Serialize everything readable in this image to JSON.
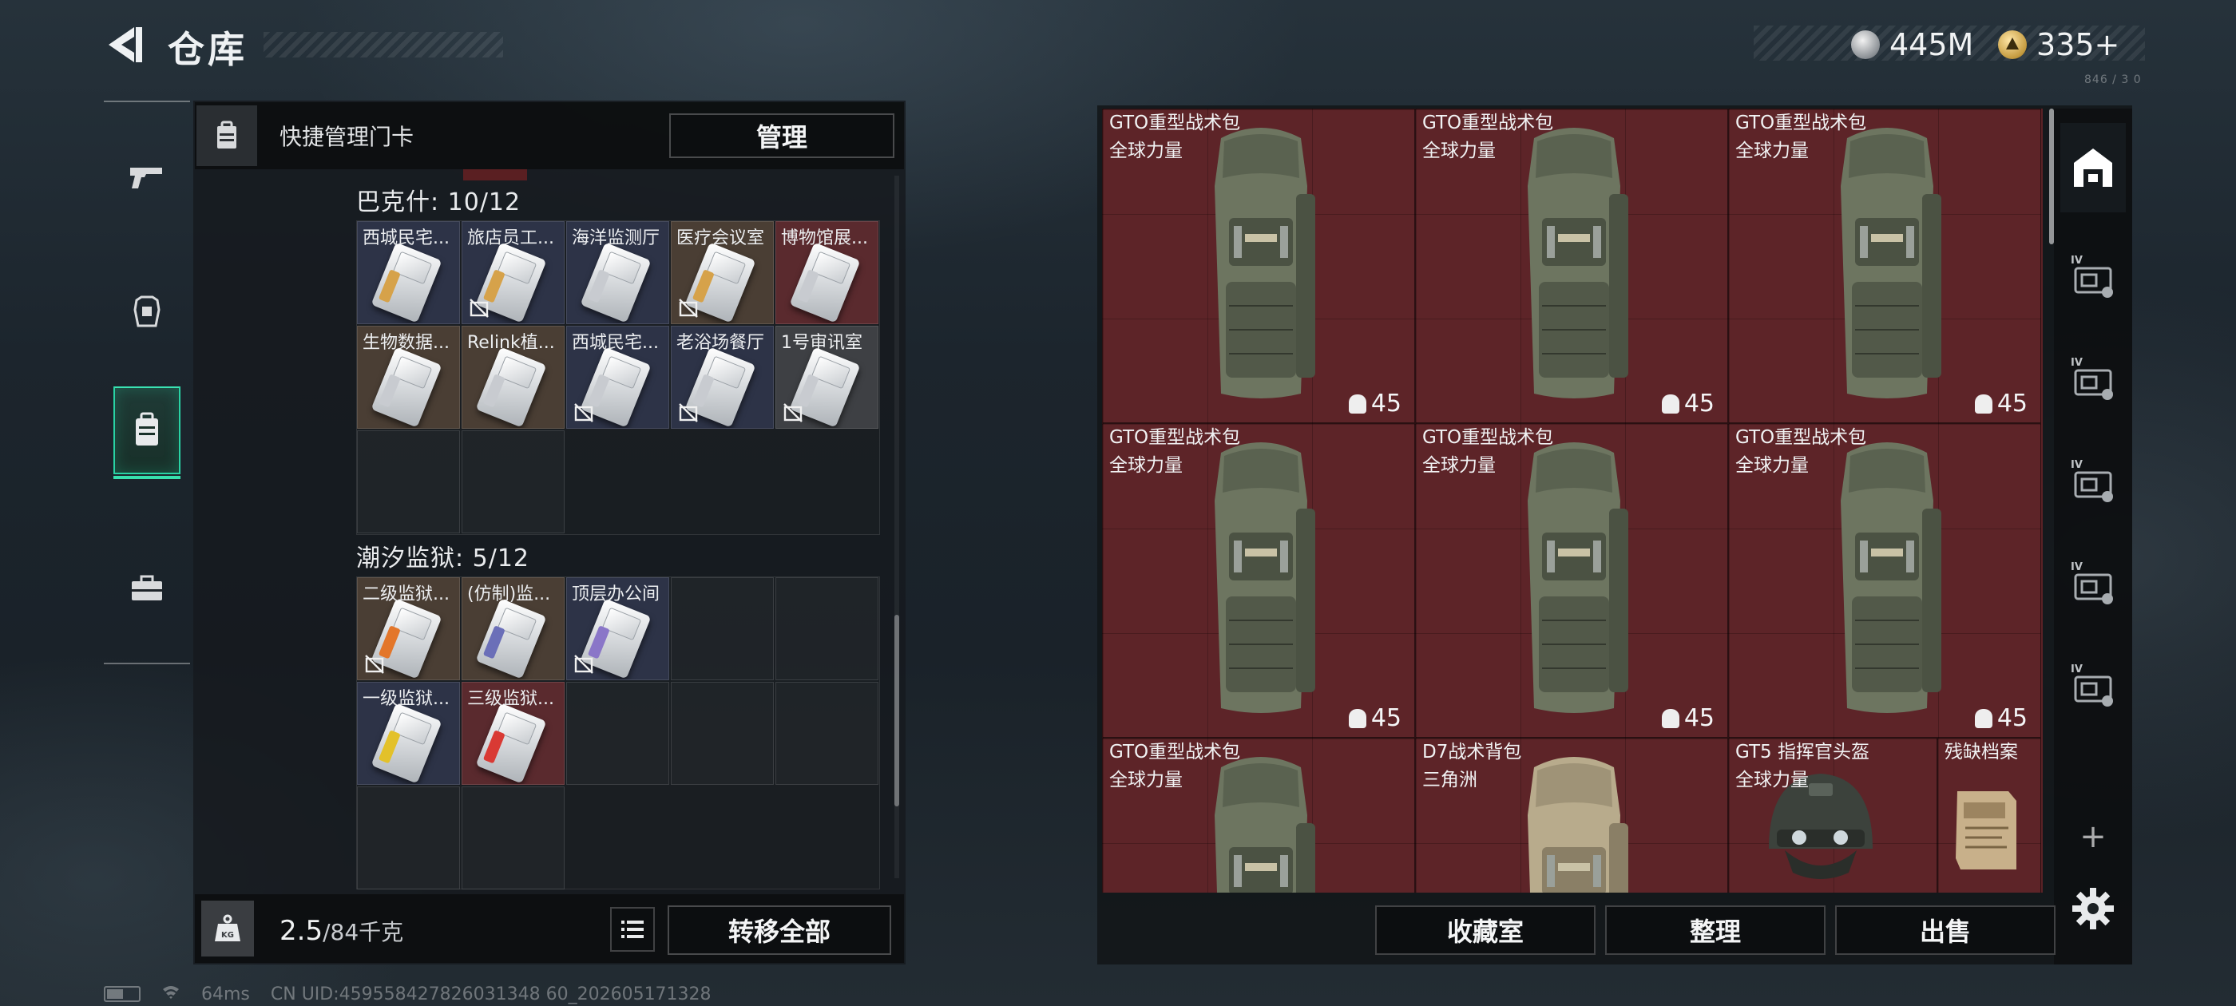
{
  "header": {
    "title": "仓库",
    "currency": [
      {
        "icon": "silver-coin-icon",
        "amount": "445M"
      },
      {
        "icon": "gold-coin-icon",
        "amount": "335+"
      }
    ],
    "version": "846 / 3 0"
  },
  "nav": [
    {
      "id": "weapons",
      "icon": "pistol-icon",
      "active": false
    },
    {
      "id": "gear",
      "icon": "armor-icon",
      "active": false
    },
    {
      "id": "keycards",
      "icon": "keycard-holder-icon",
      "active": true
    },
    {
      "id": "toolbox",
      "icon": "toolbox-icon",
      "active": false
    }
  ],
  "quick_manage": {
    "label": "快捷管理门卡",
    "button": "管理"
  },
  "sections": [
    {
      "header": "巴克什: 10/12",
      "cells": [
        {
          "name": "西城民宅...",
          "bg": "navy",
          "locked": false,
          "stripe": "#d6a24a"
        },
        {
          "name": "旅店员工...",
          "bg": "navy",
          "locked": true,
          "stripe": "#d6a24a"
        },
        {
          "name": "海洋监测厅",
          "bg": "navy",
          "locked": false,
          "stripe": "#c8cbd0"
        },
        {
          "name": "医疗会议室",
          "bg": "brown",
          "locked": true,
          "stripe": "#d6a24a"
        },
        {
          "name": "博物馆展...",
          "bg": "red",
          "locked": false,
          "stripe": "#c8cbd0"
        },
        {
          "name": "生物数据...",
          "bg": "brown",
          "locked": false,
          "stripe": "#c8cbd0"
        },
        {
          "name": "Relink植...",
          "bg": "brown",
          "locked": false,
          "stripe": "#c8cbd0"
        },
        {
          "name": "西城民宅...",
          "bg": "navy",
          "locked": true,
          "stripe": "#c8cbd0"
        },
        {
          "name": "老浴场餐厅",
          "bg": "navy",
          "locked": true,
          "stripe": "#c8cbd0"
        },
        {
          "name": "1号审讯室",
          "bg": "gray",
          "locked": true,
          "stripe": "#c8cbd0"
        }
      ]
    },
    {
      "header": "潮汐监狱: 5/12",
      "cells": [
        {
          "name": "二级监狱...",
          "bg": "brown",
          "locked": true,
          "stripe": "#e3762a"
        },
        {
          "name": "(仿制)监...",
          "bg": "brown",
          "locked": false,
          "stripe": "#6b6fb8"
        },
        {
          "name": "顶层办公间",
          "bg": "navy",
          "locked": true,
          "stripe": "#8a76c8"
        },
        {
          "name": "一级监狱...",
          "bg": "navy",
          "locked": false,
          "stripe": "#e3c12a"
        },
        {
          "name": "三级监狱...",
          "bg": "red",
          "locked": false,
          "stripe": "#d93a34"
        }
      ]
    }
  ],
  "weight": {
    "current": "2.5",
    "max": "/84千克"
  },
  "transfer_all": "转移全部",
  "items": [
    {
      "name": "GTO重型战术包",
      "sub": "全球力量",
      "count": "45",
      "kind": "backpack-olive"
    },
    {
      "name": "GTO重型战术包",
      "sub": "全球力量",
      "count": "45",
      "kind": "backpack-olive"
    },
    {
      "name": "GTO重型战术包",
      "sub": "全球力量",
      "count": "45",
      "kind": "backpack-olive"
    },
    {
      "name": "GTO重型战术包",
      "sub": "全球力量",
      "count": "45",
      "kind": "backpack-olive"
    },
    {
      "name": "GTO重型战术包",
      "sub": "全球力量",
      "count": "45",
      "kind": "backpack-olive"
    },
    {
      "name": "GTO重型战术包",
      "sub": "全球力量",
      "count": "45",
      "kind": "backpack-olive"
    },
    {
      "name": "GTO重型战术包",
      "sub": "全球力量",
      "count": "",
      "kind": "backpack-olive"
    },
    {
      "name": "D7战术背包",
      "sub": "三角洲",
      "count": "",
      "kind": "backpack-tan"
    },
    {
      "name": "GT5 指挥官头盔",
      "sub": "全球力量",
      "count": "",
      "kind": "helmet"
    },
    {
      "name": "残缺档案",
      "sub": "",
      "count": "",
      "kind": "document"
    }
  ],
  "right_tools": [
    {
      "icon": "warehouse-icon",
      "label": ""
    },
    {
      "icon": "storage-case-1-icon",
      "label": "IV"
    },
    {
      "icon": "storage-case-2-icon",
      "label": "IV"
    },
    {
      "icon": "storage-case-3-icon",
      "label": "IV"
    },
    {
      "icon": "storage-case-4-icon",
      "label": "IV"
    },
    {
      "icon": "storage-case-5-icon",
      "label": "IV"
    },
    {
      "icon": "add-icon",
      "label": "+"
    },
    {
      "icon": "settings-icon",
      "label": ""
    }
  ],
  "bottom_buttons": {
    "collection": "收藏室",
    "organize": "整理",
    "sell": "出售"
  },
  "status": {
    "ping": "64ms",
    "uid": "CN UID:459558427826031348 60_202605171328"
  }
}
